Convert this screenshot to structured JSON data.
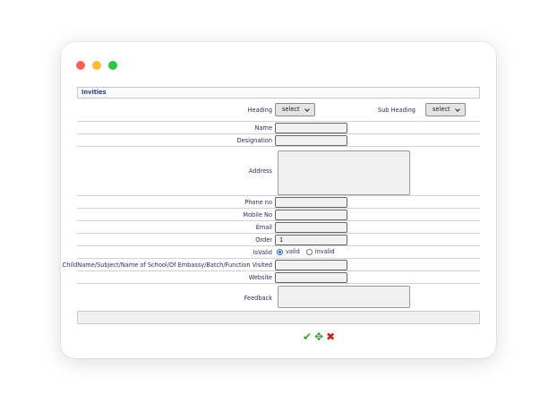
{
  "form": {
    "title": "Invities",
    "fields": {
      "heading": {
        "label": "Heading",
        "value": "select"
      },
      "sub_heading": {
        "label": "Sub Heading",
        "value": "select"
      },
      "name": {
        "label": "Name",
        "value": ""
      },
      "designation": {
        "label": "Designation",
        "value": ""
      },
      "address": {
        "label": "Address",
        "value": ""
      },
      "phone": {
        "label": "Phone no",
        "value": ""
      },
      "mobile": {
        "label": "Mobile No",
        "value": ""
      },
      "email": {
        "label": "Email",
        "value": ""
      },
      "order": {
        "label": "Order",
        "value": "1"
      },
      "isvalid": {
        "label": "IsValid",
        "options": [
          "valid",
          "invalid"
        ],
        "selected": "valid"
      },
      "child": {
        "label": "ChildName/Subject/Name of School/Of Embassy/Batch/Function Visited",
        "value": ""
      },
      "website": {
        "label": "Website",
        "value": ""
      },
      "feedback": {
        "label": "Feedback",
        "value": ""
      }
    },
    "actions": {
      "save_icon": "checkmark-icon",
      "reset_icon": "reset-icon",
      "cancel_icon": "cancel-icon",
      "save_glyph": "✔",
      "reset_glyph": "✥",
      "cancel_glyph": "✖"
    }
  }
}
